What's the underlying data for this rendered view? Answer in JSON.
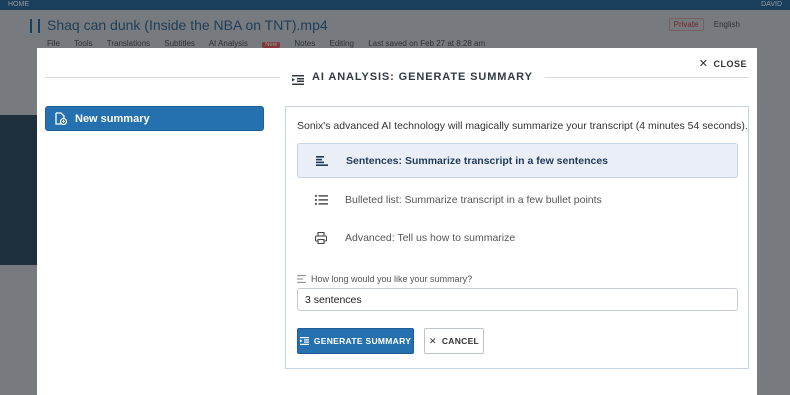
{
  "background": {
    "home_label": "HOME",
    "user_label": "DAVID",
    "file_title": "Shaq can dunk (Inside the NBA on TNT).mp4",
    "menu": [
      "File",
      "Tools",
      "Translations",
      "Subtitles",
      "AI Analysis"
    ],
    "new_badge": "New",
    "menu_extra": [
      "Notes",
      "Editing",
      "Last saved on Feb 27 at 8:28 am"
    ],
    "private_label": "Private",
    "language_label": "English"
  },
  "modal": {
    "title": "AI ANALYSIS: GENERATE SUMMARY",
    "close_label": "CLOSE",
    "new_summary_label": "New summary",
    "intro": "Sonix's advanced AI technology will magically summarize your transcript (4 minutes 54 seconds).",
    "options": [
      {
        "label": "Sentences: Summarize transcript in a few sentences",
        "icon": "align-left-icon",
        "selected": true
      },
      {
        "label": "Bulleted list: Summarize transcript in a few bullet points",
        "icon": "list-icon",
        "selected": false
      },
      {
        "label": "Advanced: Tell us how to summarize",
        "icon": "printer-icon",
        "selected": false
      }
    ],
    "question_label": "How long would you like your summary?",
    "summary_length_value": "3 sentences",
    "generate_label": "GENERATE SUMMARY",
    "cancel_label": "CANCEL"
  },
  "colors": {
    "primary": "#2571b0",
    "selected_bg": "#e9eef7",
    "border": "#c6d2e6"
  }
}
